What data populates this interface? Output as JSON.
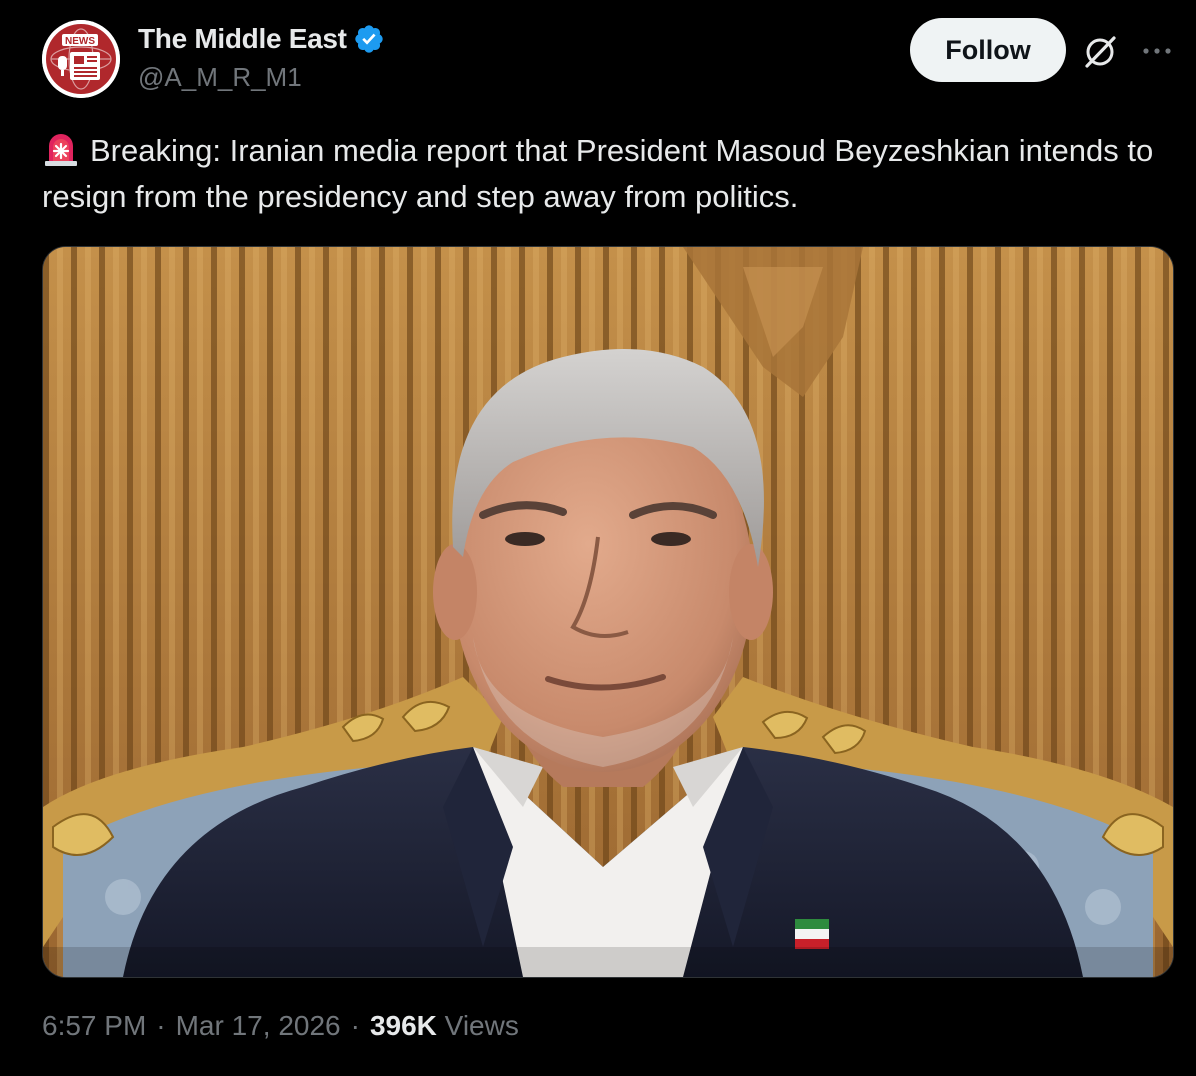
{
  "account": {
    "display_name": "The Middle East",
    "handle": "@A_M_R_M1",
    "avatar_badge": "NEWS",
    "verified": true,
    "avatar_color": "#b0282c",
    "verified_color": "#1d9bf0"
  },
  "actions": {
    "follow_label": "Follow",
    "grok_icon": "grok-slash-icon",
    "more_icon": "more-horizontal-icon"
  },
  "tweet": {
    "emoji": "siren-icon",
    "text": "Breaking: Iranian media report that President Masoud Beyzeshkian intends to resign from the presidency and step away from politics."
  },
  "media": {
    "type": "photo",
    "subject": "man in dark suit seated in ornate chair"
  },
  "meta": {
    "time": "6:57 PM",
    "separator": "·",
    "date": "Mar 17, 2026",
    "views_count": "396K",
    "views_label": "Views"
  },
  "colors": {
    "background": "#000000",
    "text_primary": "#e7e9ea",
    "text_secondary": "#71767b",
    "button_bg": "#eff3f4"
  }
}
